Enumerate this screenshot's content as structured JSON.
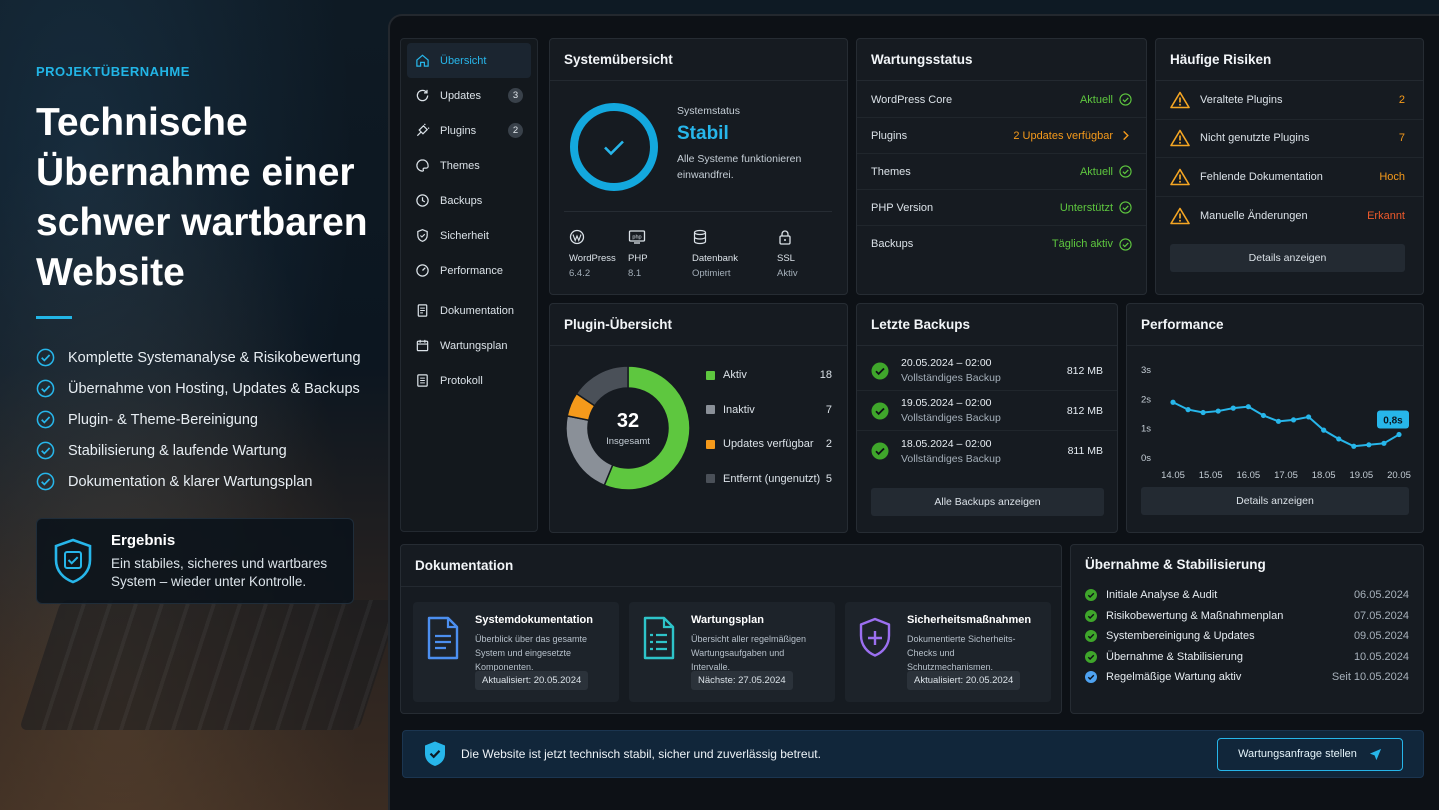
{
  "left": {
    "kicker": "PROJEKTÜBERNAHME",
    "headline": "Technische Übernahme einer schwer wartbaren Website",
    "bullets": [
      "Komplette Systemanalyse & Risikobewertung",
      "Übernahme von Hosting, Updates & Backups",
      "Plugin- & Theme-Bereinigung",
      "Stabilisierung & laufende Wartung",
      "Dokumentation & klarer Wartungsplan"
    ],
    "result_title": "Ergebnis",
    "result_text": "Ein stabiles, sicheres und wartbares System – wieder unter Kontrolle."
  },
  "sidebar": {
    "items": [
      {
        "label": "Übersicht",
        "icon": "home-icon",
        "active": true
      },
      {
        "label": "Updates",
        "icon": "refresh-icon",
        "badge": "3"
      },
      {
        "label": "Plugins",
        "icon": "plug-icon",
        "badge": "2"
      },
      {
        "label": "Themes",
        "icon": "palette-icon"
      },
      {
        "label": "Backups",
        "icon": "clock-icon"
      },
      {
        "label": "Sicherheit",
        "icon": "shield-icon"
      },
      {
        "label": "Performance",
        "icon": "gauge-icon"
      },
      {
        "label": "Dokumentation",
        "icon": "document-icon"
      },
      {
        "label": "Wartungsplan",
        "icon": "calendar-icon"
      },
      {
        "label": "Protokoll",
        "icon": "list-icon"
      }
    ]
  },
  "system": {
    "title": "Systemübersicht",
    "status_label": "Systemstatus",
    "status": "Stabil",
    "status_text": "Alle Systeme funktionieren einwandfrei.",
    "stats": [
      {
        "label": "WordPress",
        "value": "6.4.2",
        "icon": "wordpress-icon"
      },
      {
        "label": "PHP",
        "value": "8.1",
        "icon": "php-icon"
      },
      {
        "label": "Datenbank",
        "value": "Optimiert",
        "icon": "database-icon"
      },
      {
        "label": "SSL",
        "value": "Aktiv",
        "icon": "lock-icon"
      }
    ]
  },
  "wartung": {
    "title": "Wartungsstatus",
    "rows": [
      {
        "label": "WordPress Core",
        "value": "Aktuell",
        "color": "#5ec73f",
        "icon": "check-circle-icon"
      },
      {
        "label": "Plugins",
        "value": "2 Updates verfügbar",
        "color": "#f59a1b",
        "icon": "chevron-right-icon"
      },
      {
        "label": "Themes",
        "value": "Aktuell",
        "color": "#5ec73f",
        "icon": "check-circle-icon"
      },
      {
        "label": "PHP Version",
        "value": "Unterstützt",
        "color": "#5ec73f",
        "icon": "check-circle-icon"
      },
      {
        "label": "Backups",
        "value": "Täglich aktiv",
        "color": "#5ec73f",
        "icon": "check-circle-icon"
      }
    ]
  },
  "risiken": {
    "title": "Häufige Risiken",
    "rows": [
      {
        "label": "Veraltete Plugins",
        "value": "2",
        "color": "#f59a1b"
      },
      {
        "label": "Nicht genutzte Plugins",
        "value": "7",
        "color": "#f59a1b"
      },
      {
        "label": "Fehlende Dokumentation",
        "value": "Hoch",
        "color": "#f59a1b"
      },
      {
        "label": "Manuelle Änderungen",
        "value": "Erkannt",
        "color": "#ef5a2b"
      }
    ],
    "button": "Details anzeigen"
  },
  "plugins": {
    "title": "Plugin-Übersicht",
    "total": "32",
    "total_label": "Insgesamt",
    "chart_data": {
      "type": "pie",
      "title": "",
      "categories": [
        "Aktiv",
        "Inaktiv",
        "Updates verfügbar",
        "Entfernt (ungenutzt)"
      ],
      "values": [
        18,
        7,
        2,
        5
      ],
      "colors": [
        "#5ec73f",
        "#8a9098",
        "#f59a1b",
        "#4a5058"
      ]
    }
  },
  "backups": {
    "title": "Letzte Backups",
    "rows": [
      {
        "date": "20.05.2024 – 02:00",
        "type": "Vollständiges Backup",
        "size": "812 MB"
      },
      {
        "date": "19.05.2024 – 02:00",
        "type": "Vollständiges Backup",
        "size": "812 MB"
      },
      {
        "date": "18.05.2024 – 02:00",
        "type": "Vollständiges Backup",
        "size": "811 MB"
      }
    ],
    "button": "Alle Backups anzeigen"
  },
  "performance": {
    "title": "Performance",
    "button": "Details anzeigen",
    "callout": "0,8s",
    "chart_data": {
      "type": "line",
      "title": "",
      "xlabel": "",
      "ylabel": "",
      "ylim": [
        0,
        3
      ],
      "yticks": [
        "0s",
        "1s",
        "2s",
        "3s"
      ],
      "xticks": [
        "14.05",
        "15.05",
        "16.05",
        "17.05",
        "18.05",
        "19.05",
        "20.05"
      ],
      "x": [
        0,
        0.4,
        0.8,
        1.2,
        1.6,
        2,
        2.4,
        2.8,
        3.2,
        3.6,
        4,
        4.4,
        4.8,
        5.2,
        5.6,
        6
      ],
      "y": [
        1.9,
        1.65,
        1.55,
        1.6,
        1.7,
        1.75,
        1.45,
        1.25,
        1.3,
        1.4,
        0.95,
        0.65,
        0.4,
        0.45,
        0.5,
        0.8
      ],
      "series_color": "#27b6ea",
      "grid": false
    }
  },
  "doku": {
    "title": "Dokumentation",
    "items": [
      {
        "title": "Systemdokumentation",
        "text": "Überblick über das gesamte System und eingesetzte Komponenten.",
        "tag": "Aktualisiert: 20.05.2024",
        "icon": "document-icon",
        "color": "#4c8ff0"
      },
      {
        "title": "Wartungsplan",
        "text": "Übersicht aller regelmäßigen Wartungsaufgaben und Intervalle.",
        "tag": "Nächste: 27.05.2024",
        "icon": "checklist-icon",
        "color": "#2ec4c9"
      },
      {
        "title": "Sicherheitsmaßnahmen",
        "text": "Dokumentierte Sicherheits-Checks und Schutzmechanismen.",
        "tag": "Aktualisiert: 20.05.2024",
        "icon": "shield-plus-icon",
        "color": "#9b6ff0"
      }
    ]
  },
  "uebernahme": {
    "title": "Übernahme & Stabilisierung",
    "items": [
      {
        "label": "Initiale Analyse & Audit",
        "date": "06.05.2024",
        "color": "#5ec73f"
      },
      {
        "label": "Risikobewertung & Maßnahmenplan",
        "date": "07.05.2024",
        "color": "#5ec73f"
      },
      {
        "label": "Systembereinigung & Updates",
        "date": "09.05.2024",
        "color": "#5ec73f"
      },
      {
        "label": "Übernahme & Stabilisierung",
        "date": "10.05.2024",
        "color": "#5ec73f"
      },
      {
        "label": "Regelmäßige Wartung aktiv",
        "date": "Seit 10.05.2024",
        "color": "#4ea2f0"
      }
    ]
  },
  "footer": {
    "text": "Die Website ist jetzt technisch stabil, sicher und zuverlässig betreut.",
    "button": "Wartungsanfrage stellen"
  }
}
